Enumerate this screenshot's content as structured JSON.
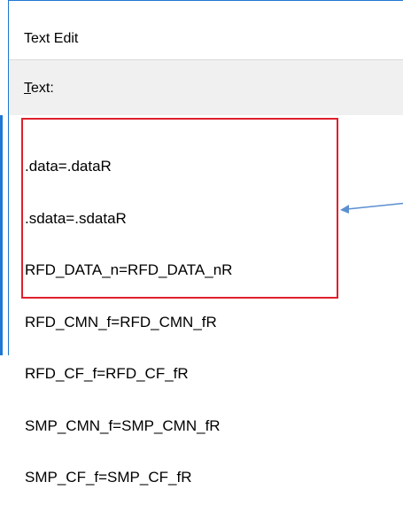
{
  "window": {
    "title": "Text Edit"
  },
  "toolbar": {
    "text_label_mnemonic": "T",
    "text_label_rest": "ext:"
  },
  "editor": {
    "lines": [
      ".data=.dataR",
      ".sdata=.sdataR",
      "RFD_DATA_n=RFD_DATA_nR",
      "RFD_CMN_f=RFD_CMN_fR",
      "RFD_CF_f=RFD_CF_fR",
      "SMP_CMN_f=SMP_CMN_fR",
      "SMP_CF_f=SMP_CF_fR"
    ]
  },
  "colors": {
    "accent": "#1f77d4",
    "highlight": "#e0202c",
    "toolbar_bg": "#f0f0f0"
  }
}
